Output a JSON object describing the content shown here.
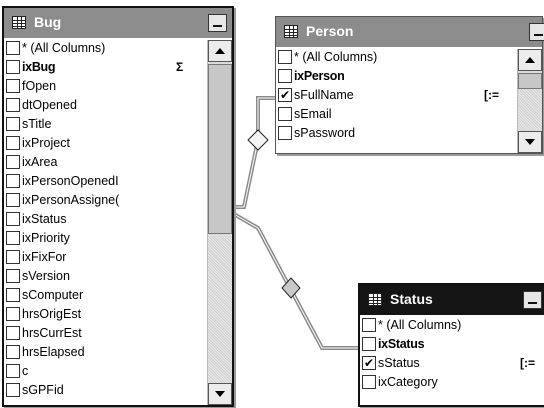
{
  "tables": {
    "bug": {
      "title": "Bug",
      "columns": [
        {
          "name": "* (All Columns)",
          "bold": false,
          "checked": false,
          "marker": ""
        },
        {
          "name": "ixBug",
          "bold": true,
          "checked": false,
          "marker": "Σ"
        },
        {
          "name": "fOpen",
          "bold": false,
          "checked": false,
          "marker": ""
        },
        {
          "name": "dtOpened",
          "bold": false,
          "checked": false,
          "marker": ""
        },
        {
          "name": "sTitle",
          "bold": false,
          "checked": false,
          "marker": ""
        },
        {
          "name": "ixProject",
          "bold": false,
          "checked": false,
          "marker": ""
        },
        {
          "name": "ixArea",
          "bold": false,
          "checked": false,
          "marker": ""
        },
        {
          "name": "ixPersonOpenedI",
          "bold": false,
          "checked": false,
          "marker": ""
        },
        {
          "name": "ixPersonAssigne(",
          "bold": false,
          "checked": false,
          "marker": ""
        },
        {
          "name": "ixStatus",
          "bold": false,
          "checked": false,
          "marker": ""
        },
        {
          "name": "ixPriority",
          "bold": false,
          "checked": false,
          "marker": ""
        },
        {
          "name": "ixFixFor",
          "bold": false,
          "checked": false,
          "marker": ""
        },
        {
          "name": "sVersion",
          "bold": false,
          "checked": false,
          "marker": ""
        },
        {
          "name": "sComputer",
          "bold": false,
          "checked": false,
          "marker": ""
        },
        {
          "name": "hrsOrigEst",
          "bold": false,
          "checked": false,
          "marker": ""
        },
        {
          "name": "hrsCurrEst",
          "bold": false,
          "checked": false,
          "marker": ""
        },
        {
          "name": "hrsElapsed",
          "bold": false,
          "checked": false,
          "marker": ""
        },
        {
          "name": "c",
          "bold": false,
          "checked": false,
          "marker": ""
        },
        {
          "name": "sGPFid",
          "bold": false,
          "checked": false,
          "marker": ""
        }
      ]
    },
    "person": {
      "title": "Person",
      "columns": [
        {
          "name": "* (All Columns)",
          "bold": false,
          "checked": false,
          "marker": ""
        },
        {
          "name": "ixPerson",
          "bold": true,
          "checked": false,
          "marker": ""
        },
        {
          "name": "sFullName",
          "bold": false,
          "checked": true,
          "marker": "[:="
        },
        {
          "name": "sEmail",
          "bold": false,
          "checked": false,
          "marker": ""
        },
        {
          "name": "sPassword",
          "bold": false,
          "checked": false,
          "marker": ""
        }
      ]
    },
    "status": {
      "title": "Status",
      "columns": [
        {
          "name": "* (All Columns)",
          "bold": false,
          "checked": false,
          "marker": ""
        },
        {
          "name": "ixStatus",
          "bold": true,
          "checked": false,
          "marker": ""
        },
        {
          "name": "sStatus",
          "bold": false,
          "checked": true,
          "marker": "[:="
        },
        {
          "name": "ixCategory",
          "bold": false,
          "checked": false,
          "marker": ""
        }
      ]
    }
  },
  "colors": {
    "active_title_bar": "#141414",
    "inactive_title_bar": "#8c8c8c",
    "relationship_line": "#8a8a8a"
  },
  "icons": {
    "table": "grid-table-icon",
    "minimize": "minimize-icon",
    "join": "diamond-join-icon",
    "sort": "sigma-icon"
  }
}
